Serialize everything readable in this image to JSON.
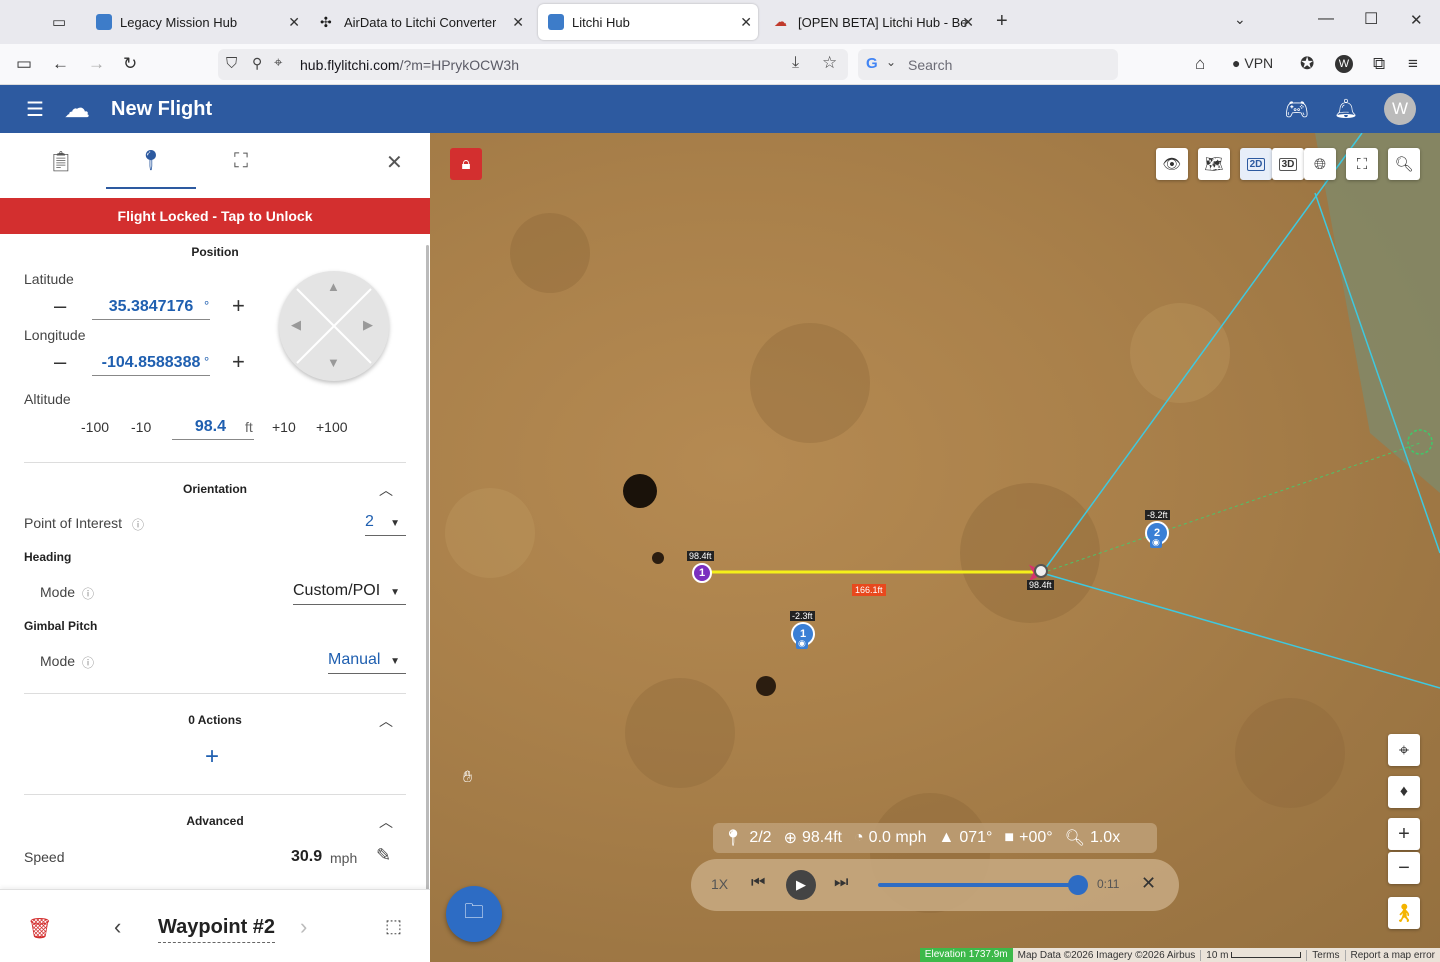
{
  "browser": {
    "tabs": [
      {
        "label": "Legacy Mission Hub",
        "active": false
      },
      {
        "label": "AirData to Litchi Converter",
        "active": false
      },
      {
        "label": "Litchi Hub",
        "active": true
      },
      {
        "label": "[OPEN BETA] Litchi Hub - Beta F",
        "active": false
      }
    ],
    "url_domain": "hub.flylitchi.com",
    "url_path": "/?m=HPrykOCW3h",
    "search_placeholder": "Search",
    "vpn_label": "VPN"
  },
  "app": {
    "title": "New Flight",
    "avatar_letter": "W"
  },
  "panel": {
    "lock_banner": "Flight Locked - Tap to Unlock",
    "position_title": "Position",
    "latitude_label": "Latitude",
    "latitude_value": "35.3847176",
    "longitude_label": "Longitude",
    "longitude_value": "-104.8588388",
    "degree_unit": "°",
    "altitude_label": "Altitude",
    "altitude_value": "98.4",
    "altitude_unit": "ft",
    "alt_buttons": [
      "-100",
      "-10",
      "+10",
      "+100"
    ],
    "orientation_title": "Orientation",
    "poi_label": "Point of Interest",
    "poi_value": "2",
    "heading_label": "Heading",
    "heading_mode_label": "Mode",
    "heading_mode_value": "Custom/POI",
    "gimbal_label": "Gimbal Pitch",
    "gimbal_mode_label": "Mode",
    "gimbal_mode_value": "Manual",
    "actions_title": "0 Actions",
    "advanced_title": "Advanced",
    "speed_label": "Speed",
    "speed_value": "30.9",
    "speed_unit": "mph",
    "waypoint_title": "Waypoint #2"
  },
  "map": {
    "wp1_alt": "98.4ft",
    "wp1_num": "1",
    "wp2_alt": "98.4ft",
    "segment_dist": "166.1ft",
    "poi1_alt": "-2.3ft",
    "poi1_num": "1",
    "poi2_alt": "-8.2ft",
    "poi2_num": "2",
    "info_wp": "2/2",
    "info_alt": "98.4ft",
    "info_speed": "0.0 mph",
    "info_heading": "071°",
    "info_gimbal": "+00°",
    "info_zoom": "1.0x",
    "playback_speed": "1X",
    "playback_progress": 1.0,
    "playback_time": "0:11",
    "elevation": "Elevation 1737.9m",
    "map_data": "Map Data ©2026 Imagery ©2026 Airbus",
    "scale": "10 m",
    "terms": "Terms",
    "report": "Report a map error"
  },
  "colors": {
    "brand_blue": "#2d5aa0",
    "lock_red": "#d32f2f",
    "path_yellow": "#f5f01a",
    "fov_cyan": "#3ec9e0"
  }
}
